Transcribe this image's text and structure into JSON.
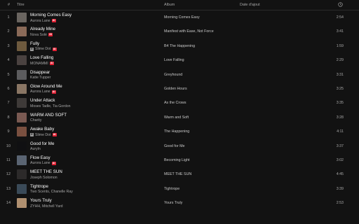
{
  "header": {
    "num": "#",
    "title": "Titre",
    "album": "Album",
    "date_added": "Date d'ajout",
    "duration_icon": "clock-icon"
  },
  "tracks": [
    {
      "num": "1",
      "title": "Morning Comes Easy",
      "artist": "Aurora Lane",
      "ai": "AI",
      "explicit": "",
      "album": "Morning Comes Easy",
      "duration": "2:54",
      "cover": "#6a6560"
    },
    {
      "num": "2",
      "title": "Already Mine",
      "artist": "Nova Solè",
      "ai": "AI",
      "explicit": "",
      "album": "Manifest with Ease, Not Force",
      "duration": "3:41",
      "cover": "#8a6a58"
    },
    {
      "num": "3",
      "title": "Fully",
      "artist": "Slime Dot",
      "ai": "AI",
      "explicit": "E",
      "album": "B4 The Happening",
      "duration": "1:59",
      "cover": "#6e5a3e"
    },
    {
      "num": "4",
      "title": "Love Falling",
      "artist": "MONAMMI",
      "ai": "AI",
      "explicit": "",
      "album": "Love Falling",
      "duration": "2:29",
      "cover": "#4a4240"
    },
    {
      "num": "5",
      "title": "Disappear",
      "artist": "Katie Tupper",
      "ai": "",
      "explicit": "",
      "album": "Greyhound",
      "duration": "3:31",
      "cover": "#5c5c5e"
    },
    {
      "num": "6",
      "title": "Glow Around Me",
      "artist": "Aurora Lane",
      "ai": "AI",
      "explicit": "",
      "album": "Golden Hours",
      "duration": "3:25",
      "cover": "#8a7664"
    },
    {
      "num": "7",
      "title": "Under Attack",
      "artist": "Moses Tadle, Tia Gordon",
      "ai": "",
      "explicit": "",
      "album": "As the Crows",
      "duration": "3:35",
      "cover": "#3e3a38"
    },
    {
      "num": "8",
      "title": "WARM AND SOFT",
      "artist": "Charity",
      "ai": "",
      "explicit": "",
      "album": "Warm and Soft",
      "duration": "3:28",
      "cover": "#7a5a52"
    },
    {
      "num": "9",
      "title": "Awake Baby",
      "artist": "Slime Dot",
      "ai": "AI",
      "explicit": "E",
      "album": "The Happening",
      "duration": "4:11",
      "cover": "#7a5040"
    },
    {
      "num": "10",
      "title": "Good for Me",
      "artist": "Auryln",
      "ai": "",
      "explicit": "",
      "album": "Good for Me",
      "duration": "3:37",
      "cover": "#101012"
    },
    {
      "num": "11",
      "title": "Flow Easy",
      "artist": "Aurora Lane",
      "ai": "AI",
      "explicit": "",
      "album": "Becoming Light",
      "duration": "3:02",
      "cover": "#5a6472"
    },
    {
      "num": "12",
      "title": "MEET THE SUN",
      "artist": "Joseph Solomon",
      "ai": "",
      "explicit": "",
      "album": "MEET THE SUN",
      "duration": "4:45",
      "cover": "#2c2a2a"
    },
    {
      "num": "13",
      "title": "Tightrope",
      "artist": "Two Scents, Chanelle Ray",
      "ai": "",
      "explicit": "",
      "album": "Tightrope",
      "duration": "3:39",
      "cover": "#3a4a58"
    },
    {
      "num": "14",
      "title": "Yours Truly",
      "artist": "ZYHH, Mitchell Yard",
      "ai": "",
      "explicit": "",
      "album": "Yours Truly",
      "duration": "2:53",
      "cover": "#b09070"
    }
  ]
}
